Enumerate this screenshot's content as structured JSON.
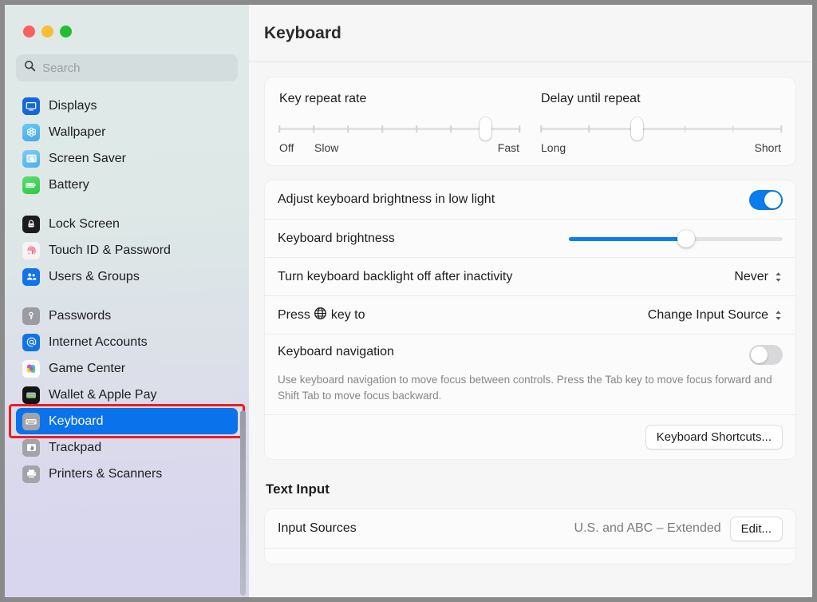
{
  "window": {
    "traffic_lights": [
      "close",
      "minimize",
      "zoom"
    ]
  },
  "sidebar": {
    "search": {
      "placeholder": "Search",
      "value": ""
    },
    "groups": [
      {
        "items": [
          {
            "label": "Displays",
            "icon": "displays-icon",
            "selected": false
          },
          {
            "label": "Wallpaper",
            "icon": "wallpaper-icon",
            "selected": false
          },
          {
            "label": "Screen Saver",
            "icon": "screensaver-icon",
            "selected": false
          },
          {
            "label": "Battery",
            "icon": "battery-icon",
            "selected": false
          }
        ]
      },
      {
        "items": [
          {
            "label": "Lock Screen",
            "icon": "lock-icon",
            "selected": false
          },
          {
            "label": "Touch ID & Password",
            "icon": "touchid-icon",
            "selected": false
          },
          {
            "label": "Users & Groups",
            "icon": "users-icon",
            "selected": false
          }
        ]
      },
      {
        "items": [
          {
            "label": "Passwords",
            "icon": "key-icon",
            "selected": false
          },
          {
            "label": "Internet Accounts",
            "icon": "at-icon",
            "selected": false
          },
          {
            "label": "Game Center",
            "icon": "gamecenter-icon",
            "selected": false
          },
          {
            "label": "Wallet & Apple Pay",
            "icon": "wallet-icon",
            "selected": false
          },
          {
            "label": "Keyboard",
            "icon": "keyboard-icon",
            "selected": true
          },
          {
            "label": "Trackpad",
            "icon": "trackpad-icon",
            "selected": false
          },
          {
            "label": "Printers & Scanners",
            "icon": "printer-icon",
            "selected": false
          }
        ]
      }
    ]
  },
  "header": {
    "title": "Keyboard"
  },
  "main": {
    "key_repeat": {
      "title": "Key repeat rate",
      "ticks": 8,
      "value_index": 6,
      "label_left": "Off",
      "label_second": "Slow",
      "label_right": "Fast"
    },
    "delay_until_repeat": {
      "title": "Delay until repeat",
      "ticks": 6,
      "value_index": 2,
      "label_left": "Long",
      "label_right": "Short"
    },
    "adjust_brightness": {
      "label": "Adjust keyboard brightness in low light",
      "enabled": true
    },
    "keyboard_brightness": {
      "label": "Keyboard brightness",
      "percent": 55
    },
    "backlight_off": {
      "label": "Turn keyboard backlight off after inactivity",
      "value": "Never"
    },
    "globe_key": {
      "label_before": "Press",
      "label_after": "key to",
      "icon": "globe-icon",
      "value": "Change Input Source"
    },
    "keyboard_navigation": {
      "label": "Keyboard navigation",
      "description": "Use keyboard navigation to move focus between controls. Press the Tab key to move focus forward and Shift Tab to move focus backward.",
      "enabled": false
    },
    "shortcuts_button": "Keyboard Shortcuts...",
    "text_input": {
      "section_title": "Text Input",
      "input_sources_label": "Input Sources",
      "input_sources_value": "U.S. and ABC – Extended",
      "edit_button": "Edit..."
    }
  },
  "annotation": {
    "target": "Keyboard",
    "color": "#ee1c22"
  },
  "colors": {
    "accent": "#0a72eb",
    "toggle_on": "#0b7ceb",
    "toggle_off": "#d8d8da"
  }
}
